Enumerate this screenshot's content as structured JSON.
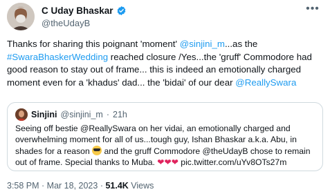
{
  "author": {
    "name": "C Uday Bhaskar",
    "handle": "@theUdayB"
  },
  "tweet": {
    "t1": "Thanks for sharing this poignant  'moment' ",
    "mention1": "@sinjini_m",
    "t2": "...as the ",
    "hashtag": "#SwaraBhaskerWedding",
    "t3": " reached closure /Yes...the 'gruff' Commodore had good reason to stay out of frame... this is indeed an emotionally charged moment even for a 'khadus' dad... the 'bidai' of our dear ",
    "mention2": "@ReallySwara"
  },
  "quote": {
    "name": "Sinjini",
    "handle": "@sinjini_m",
    "dot": "·",
    "time": "21h",
    "text1": "Seeing off bestie @ReallySwara on her vidai, an emotionally charged and overwhelming moment for all of us...tough guy, Ishan Bhaskar a.k.a. Abu, in shades for a reason ",
    "text2": " and the gruff Commodore @theUdayB chose to remain out of frame. Special thanks to Muba. ",
    "hearts": "❤❤❤",
    "link": " pic.twitter.com/uYv8OTs27m"
  },
  "footer": {
    "time": "3:58 PM",
    "sep1": " · ",
    "date": "Mar 18, 2023",
    "sep2": " · ",
    "views_count": "51.4K",
    "views_label": " Views"
  },
  "colors": {
    "link": "#1d9bf0",
    "muted": "#536471",
    "verified": "#1d9bf0",
    "heart": "#e0245e"
  },
  "icons": {
    "verified": "verified-badge-icon",
    "more": "more-options-icon",
    "sunglasses": "sunglasses-emoji-icon"
  }
}
